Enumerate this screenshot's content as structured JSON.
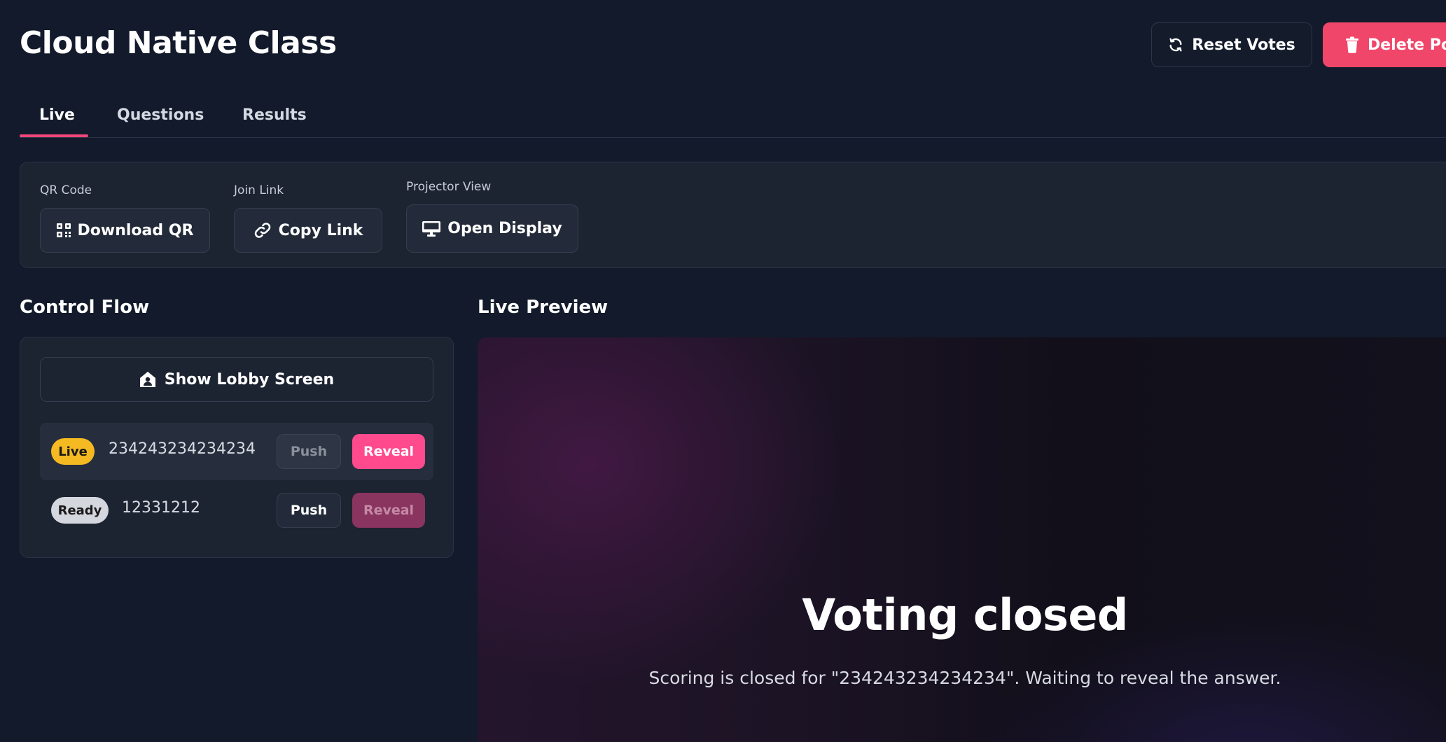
{
  "header": {
    "title": "Cloud Native Class",
    "reset_label": "Reset Votes",
    "delete_label": "Delete Poll"
  },
  "tabs": [
    {
      "label": "Live",
      "active": true
    },
    {
      "label": "Questions",
      "active": false
    },
    {
      "label": "Results",
      "active": false
    }
  ],
  "share": {
    "qr_label": "QR Code",
    "qr_button": "Download QR",
    "join_label": "Join Link",
    "join_button": "Copy Link",
    "projector_label": "Projector View",
    "projector_button": "Open Display"
  },
  "control_flow": {
    "title": "Control Flow",
    "lobby_button": "Show Lobby Screen",
    "questions": [
      {
        "status": "Live",
        "text": "234243234234234",
        "push_label": "Push",
        "reveal_label": "Reveal",
        "push_enabled": false,
        "reveal_enabled": true
      },
      {
        "status": "Ready",
        "text": "12331212",
        "push_label": "Push",
        "reveal_label": "Reveal",
        "push_enabled": true,
        "reveal_enabled": false
      }
    ]
  },
  "preview": {
    "title": "Live Preview",
    "heading": "Voting closed",
    "message": "Scoring is closed for \"234243234234234\". Waiting to reveal the answer."
  },
  "colors": {
    "background": "#121a2b",
    "accent": "#ff4a8d",
    "danger": "#f0466a",
    "live_badge": "#f5b921",
    "ready_badge": "#d4d7de"
  },
  "icons": {
    "reset": "refresh-icon",
    "delete": "trash-icon",
    "qr": "qr-code-icon",
    "link": "link-icon",
    "display": "monitor-icon",
    "lobby": "home-user-icon"
  }
}
